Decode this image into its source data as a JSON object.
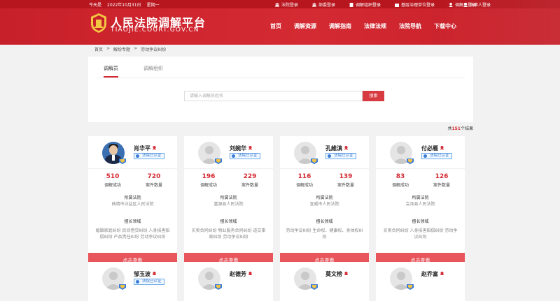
{
  "topbar": {
    "date_label": "今天是",
    "date": "2022年10月31日",
    "weekday": "星期一",
    "links": [
      "法院登录",
      "部委登录",
      "调解组织登录",
      "基层治理单位登录",
      "调解员登录"
    ],
    "user_login": "当事人登录"
  },
  "site": {
    "title": "人民法院调解平台",
    "subtitle": "TIAOJIE.COURT.GOV.CN"
  },
  "nav": [
    "首页",
    "调解资源",
    "调解指南",
    "法律法规",
    "法院导航",
    "下载中心"
  ],
  "breadcrumb": [
    "首页",
    ">",
    "解纷专题",
    ">",
    "劳动争议纠纷"
  ],
  "tabs": [
    "调解员",
    "调解组织"
  ],
  "search": {
    "placeholder": "请输入调解员姓名",
    "button": "搜索"
  },
  "total": {
    "prefix": "共",
    "count": "151",
    "suffix": "个结果"
  },
  "labels": {
    "success": "调解成功",
    "cases": "案件数量",
    "court": "所属法院",
    "field": "擅长领域",
    "view": "点击查看",
    "cert": "法院已认证"
  },
  "mediators": [
    {
      "name": "肖华平",
      "success": "510",
      "cases": "720",
      "court": "曲靖市沾益区人民法院",
      "fields": "婚姻家庭纠纷 民间借贷纠纷 人身损害赔偿纠纷 产品责任纠纷 劳动争议纠纷"
    },
    {
      "name": "刘婉华",
      "success": "196",
      "cases": "229",
      "court": "富源县人民法院",
      "fields": "买卖合同纠纷 物业服务合同纠纷 道交事故纠纷 劳动争议纠纷"
    },
    {
      "name": "孔維滇",
      "success": "116",
      "cases": "139",
      "court": "宣威市人民法院",
      "fields": "劳动争议纠纷 生命权、健康权、身体权纠纷"
    },
    {
      "name": "付必雁",
      "success": "83",
      "cases": "126",
      "court": "会泽县人民法院",
      "fields": "买卖合同纠纷 人身损害赔偿纠纷 劳动争议纠纷"
    },
    {
      "name": "邹玉波"
    },
    {
      "name": "赵德芳"
    },
    {
      "name": "莫文榜"
    },
    {
      "name": "赵乔富"
    }
  ],
  "colors": {
    "brand": "#d42a33",
    "button": "#e8565b",
    "cert": "#3a7bd5"
  }
}
